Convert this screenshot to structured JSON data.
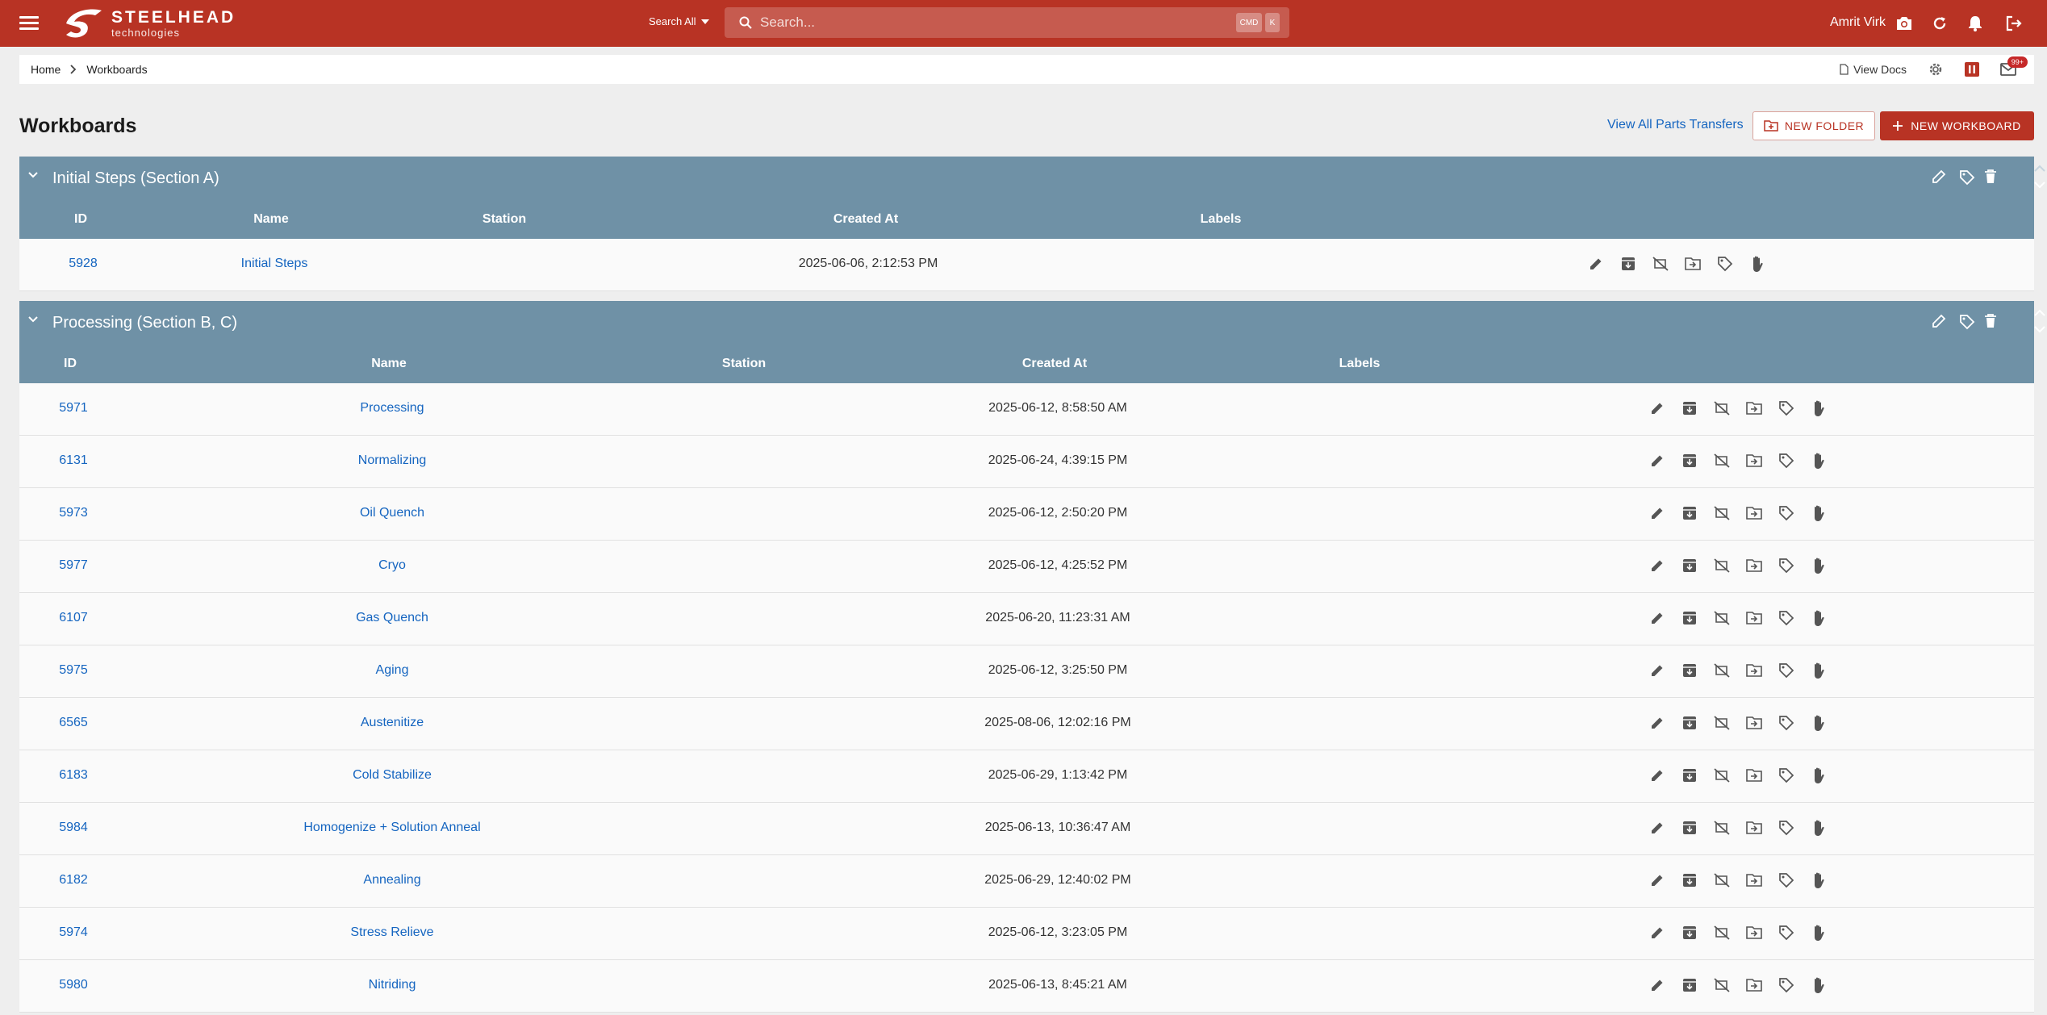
{
  "app": {
    "logo_line1": "STEELHEAD",
    "logo_line2": "technologies",
    "search_scope": "Search All",
    "search_placeholder": "Search...",
    "kbd_cmd": "CMD",
    "kbd_key": "K",
    "user_name": "Amrit Virk",
    "accent_color": "#b83324"
  },
  "breadcrumb": {
    "home": "Home",
    "current": "Workboards"
  },
  "toolbar": {
    "view_docs": "View Docs",
    "inbox_badge": "99+"
  },
  "page": {
    "title": "Workboards",
    "view_all_label": "View All Parts Transfers",
    "new_folder_label": "NEW FOLDER",
    "new_workboard_label": "NEW WORKBOARD"
  },
  "columns": {
    "id": "ID",
    "name": "Name",
    "station": "Station",
    "created": "Created At",
    "labels": "Labels"
  },
  "sections": [
    {
      "title": "Initial Steps (Section A)",
      "rows": [
        {
          "id": "5928",
          "name": "Initial Steps",
          "station": "",
          "created": "2025-06-06, 2:12:53 PM",
          "labels": ""
        }
      ]
    },
    {
      "title": "Processing (Section B, C)",
      "rows": [
        {
          "id": "5971",
          "name": "Processing",
          "station": "",
          "created": "2025-06-12, 8:58:50 AM",
          "labels": ""
        },
        {
          "id": "6131",
          "name": "Normalizing",
          "station": "",
          "created": "2025-06-24, 4:39:15 PM",
          "labels": ""
        },
        {
          "id": "5973",
          "name": "Oil Quench",
          "station": "",
          "created": "2025-06-12, 2:50:20 PM",
          "labels": ""
        },
        {
          "id": "5977",
          "name": "Cryo",
          "station": "",
          "created": "2025-06-12, 4:25:52 PM",
          "labels": ""
        },
        {
          "id": "6107",
          "name": "Gas Quench",
          "station": "",
          "created": "2025-06-20, 11:23:31 AM",
          "labels": ""
        },
        {
          "id": "5975",
          "name": "Aging",
          "station": "",
          "created": "2025-06-12, 3:25:50 PM",
          "labels": ""
        },
        {
          "id": "6565",
          "name": "Austenitize",
          "station": "",
          "created": "2025-08-06, 12:02:16 PM",
          "labels": ""
        },
        {
          "id": "6183",
          "name": "Cold Stabilize",
          "station": "",
          "created": "2025-06-29, 1:13:42 PM",
          "labels": ""
        },
        {
          "id": "5984",
          "name": "Homogenize + Solution Anneal",
          "station": "",
          "created": "2025-06-13, 10:36:47 AM",
          "labels": ""
        },
        {
          "id": "6182",
          "name": "Annealing",
          "station": "",
          "created": "2025-06-29, 12:40:02 PM",
          "labels": ""
        },
        {
          "id": "5974",
          "name": "Stress Relieve",
          "station": "",
          "created": "2025-06-12, 3:23:05 PM",
          "labels": ""
        },
        {
          "id": "5980",
          "name": "Nitriding",
          "station": "",
          "created": "2025-06-13, 8:45:21 AM",
          "labels": ""
        }
      ]
    }
  ],
  "icons": {
    "row_actions": [
      "pencil-icon",
      "archive-icon",
      "hide-icon",
      "move-to-folder-icon",
      "tag-icon",
      "hand-icon"
    ],
    "section_actions": [
      "pencil-icon",
      "tag-icon",
      "trash-icon"
    ]
  }
}
